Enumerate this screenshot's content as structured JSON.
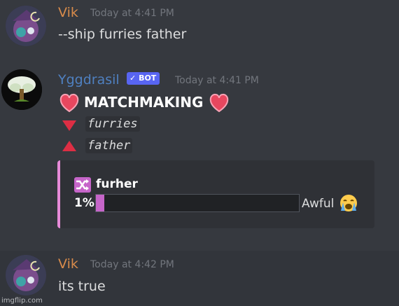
{
  "messages": [
    {
      "username": "Vik",
      "timestamp": "Today at 4:41 PM",
      "content": "--ship furries father",
      "username_color": "#d88b4b"
    },
    {
      "username": "Yggdrasil",
      "badge": "BOT",
      "timestamp": "Today at 4:41 PM",
      "username_color": "#4f80c0",
      "title": "MATCHMAKING",
      "down_name": "furries",
      "up_name": "father",
      "embed": {
        "ship_name": "furher",
        "percent_label": "1%",
        "percent_value": 0.01,
        "verdict": "Awful"
      }
    },
    {
      "username": "Vik",
      "timestamp": "Today at 4:42 PM",
      "content": "its true",
      "username_color": "#d88b4b"
    }
  ],
  "watermark": "imgflip.com"
}
